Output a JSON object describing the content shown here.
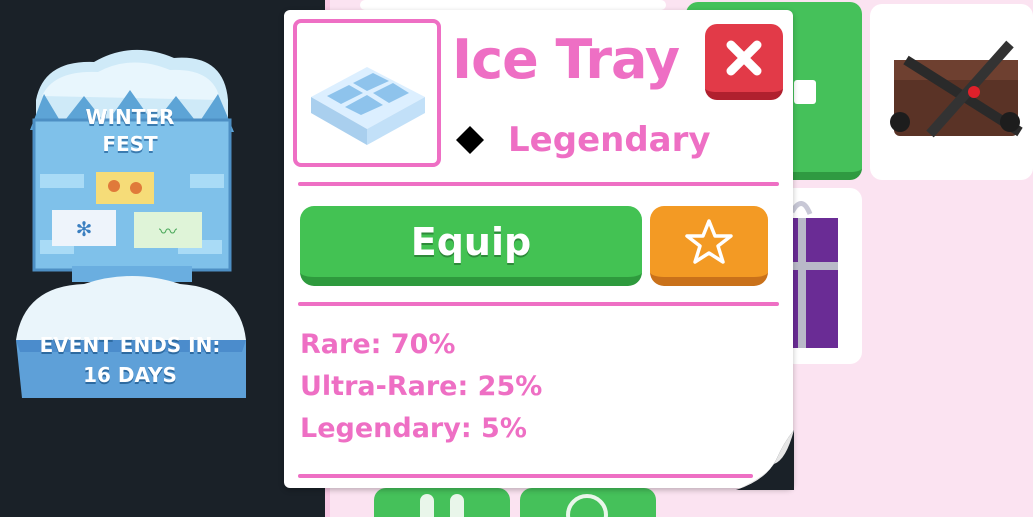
{
  "event": {
    "title_line1": "WINTER",
    "title_line2": "FEST",
    "footer_line1": "EVENT ENDS IN:",
    "footer_line2": "16 DAYS"
  },
  "item": {
    "name": "Ice Tray",
    "rarity": "Legendary",
    "rarity_color": "#ee6fc4",
    "rarity_icon": "diamond-icon",
    "icon": "ice-tray-icon"
  },
  "actions": {
    "equip_label": "Equip",
    "favorite_icon": "star-icon",
    "close_icon": "close-icon"
  },
  "odds": [
    {
      "label": "Rare: 70%"
    },
    {
      "label": "Ultra-Rare: 25%"
    },
    {
      "label": "Legendary: 5%"
    }
  ],
  "colors": {
    "accent_pink": "#ee6fc4",
    "equip_green": "#43c253",
    "favorite_orange": "#f39a24",
    "close_red": "#e23a48",
    "inventory_bg": "#fbe3f1"
  }
}
